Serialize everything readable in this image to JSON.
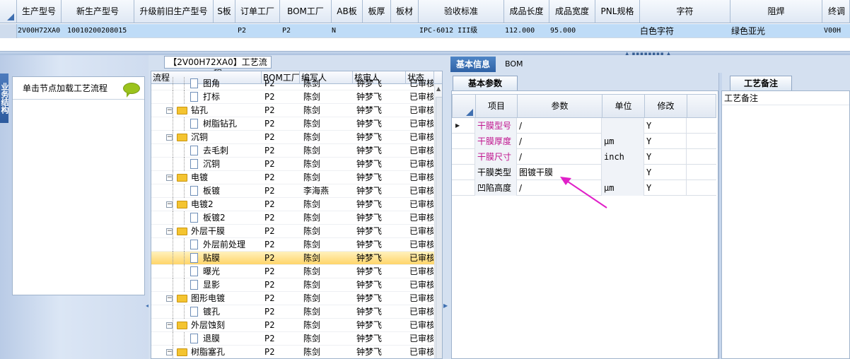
{
  "top_grid": {
    "columns": [
      "生产型号",
      "新生产型号",
      "升级前旧生产型号",
      "S板",
      "订单工厂",
      "BOM工厂",
      "AB板",
      "板厚",
      "板材",
      "验收标准",
      "成品长度",
      "成品宽度",
      "PNL规格",
      "字符",
      "阻焊",
      "终调"
    ],
    "row": {
      "model": "2V00H72XA0",
      "new_model": "10010200208015",
      "old_model": "",
      "s_board": "",
      "order_factory": "P2",
      "bom_factory": "P2",
      "ab_board": "N",
      "thickness": "",
      "material": "",
      "standard": "IPC-6012 III级",
      "length": "112.000",
      "width": "95.000",
      "pnl": "",
      "silkscreen": "白色字符",
      "solder_mask": "绿色亚光",
      "final": "V00H"
    }
  },
  "left_panel": {
    "side_tab": "业务结构",
    "hint": "单击节点加载工艺流程"
  },
  "middle_panel": {
    "title": "【2V00H72XA0】工艺流程",
    "columns": [
      "流程",
      "BOM工厂",
      "编写人",
      "核审人",
      "状态"
    ],
    "rows": [
      {
        "name": "图角",
        "bom": "P2",
        "writer": "陈剑",
        "reviewer": "钟梦飞",
        "status": "已审核"
      },
      {
        "name": "打标",
        "bom": "P2",
        "writer": "陈剑",
        "reviewer": "钟梦飞",
        "status": "已审核"
      },
      {
        "name": "钻孔",
        "bom": "P2",
        "writer": "陈剑",
        "reviewer": "钟梦飞",
        "status": "已审核"
      },
      {
        "name": "树脂钻孔",
        "bom": "P2",
        "writer": "陈剑",
        "reviewer": "钟梦飞",
        "status": "已审核"
      },
      {
        "name": "沉铜",
        "bom": "P2",
        "writer": "陈剑",
        "reviewer": "钟梦飞",
        "status": "已审核"
      },
      {
        "name": "去毛刺",
        "bom": "P2",
        "writer": "陈剑",
        "reviewer": "钟梦飞",
        "status": "已审核"
      },
      {
        "name": "沉铜",
        "bom": "P2",
        "writer": "陈剑",
        "reviewer": "钟梦飞",
        "status": "已审核"
      },
      {
        "name": "电镀",
        "bom": "P2",
        "writer": "陈剑",
        "reviewer": "钟梦飞",
        "status": "已审核"
      },
      {
        "name": "板镀",
        "bom": "P2",
        "writer": "李海燕",
        "reviewer": "钟梦飞",
        "status": "已审核"
      },
      {
        "name": "电镀2",
        "bom": "P2",
        "writer": "陈剑",
        "reviewer": "钟梦飞",
        "status": "已审核"
      },
      {
        "name": "板镀2",
        "bom": "P2",
        "writer": "陈剑",
        "reviewer": "钟梦飞",
        "status": "已审核"
      },
      {
        "name": "外层干膜",
        "bom": "P2",
        "writer": "陈剑",
        "reviewer": "钟梦飞",
        "status": "已审核"
      },
      {
        "name": "外层前处理",
        "bom": "P2",
        "writer": "陈剑",
        "reviewer": "钟梦飞",
        "status": "已审核"
      },
      {
        "name": "贴膜",
        "bom": "P2",
        "writer": "陈剑",
        "reviewer": "钟梦飞",
        "status": "已审核"
      },
      {
        "name": "曝光",
        "bom": "P2",
        "writer": "陈剑",
        "reviewer": "钟梦飞",
        "status": "已审核"
      },
      {
        "name": "显影",
        "bom": "P2",
        "writer": "陈剑",
        "reviewer": "钟梦飞",
        "status": "已审核"
      },
      {
        "name": "图形电镀",
        "bom": "P2",
        "writer": "陈剑",
        "reviewer": "钟梦飞",
        "status": "已审核"
      },
      {
        "name": "镀孔",
        "bom": "P2",
        "writer": "陈剑",
        "reviewer": "钟梦飞",
        "status": "已审核"
      },
      {
        "name": "外层蚀刻",
        "bom": "P2",
        "writer": "陈剑",
        "reviewer": "钟梦飞",
        "status": "已审核"
      },
      {
        "name": "退膜",
        "bom": "P2",
        "writer": "陈剑",
        "reviewer": "钟梦飞",
        "status": "已审核"
      },
      {
        "name": "树脂塞孔",
        "bom": "P2",
        "writer": "陈剑",
        "reviewer": "钟梦飞",
        "status": "已审核"
      }
    ]
  },
  "right_panel": {
    "tabs": [
      "基本信息",
      "BOM"
    ],
    "subtab": "基本参数",
    "columns": [
      "项目",
      "参数",
      "单位",
      "修改"
    ],
    "rows": [
      {
        "item": "干膜型号",
        "param": "/",
        "unit": "",
        "modified": "Y",
        "highlight": true
      },
      {
        "item": "干膜厚度",
        "param": "/",
        "unit": "μm",
        "modified": "Y",
        "highlight": true
      },
      {
        "item": "干膜尺寸",
        "param": "/",
        "unit": "inch",
        "modified": "Y",
        "highlight": true
      },
      {
        "item": "干膜类型",
        "param": "图镀干膜",
        "unit": "",
        "modified": "Y",
        "highlight": false
      },
      {
        "item": "凹陷高度",
        "param": "/",
        "unit": "μm",
        "modified": "Y",
        "highlight": false
      }
    ],
    "note_tab": "工艺备注",
    "note_label": "工艺备注"
  },
  "colors": {
    "accent": "#2f62a6",
    "selection_row": "#bfdcf7",
    "tree_selected": "#ffd56a",
    "magenta_text": "#c0158e",
    "annotation_arrow": "#e020c8"
  }
}
